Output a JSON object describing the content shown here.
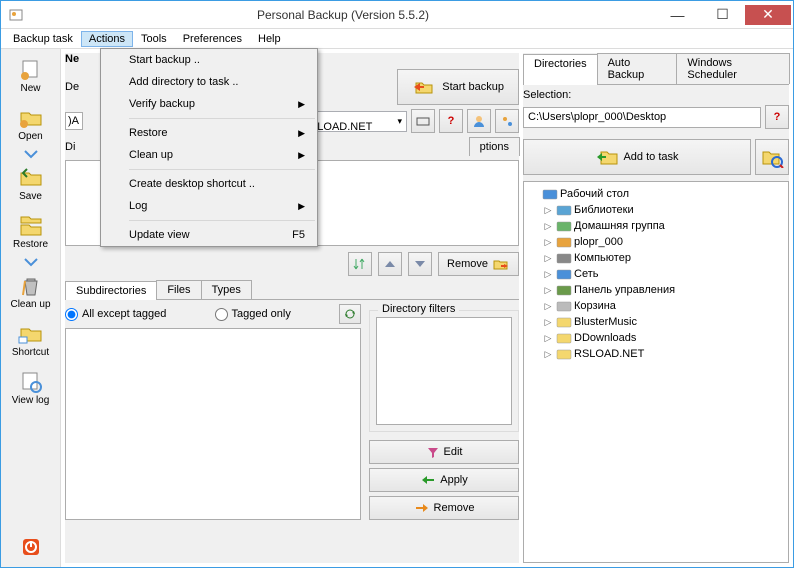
{
  "window": {
    "title": "Personal Backup (Version 5.5.2)"
  },
  "menubar": {
    "items": [
      "Backup task",
      "Actions",
      "Tools",
      "Preferences",
      "Help"
    ],
    "active": 1
  },
  "dropdown": {
    "items": [
      {
        "label": "Start backup ..",
        "type": "item"
      },
      {
        "label": "Add directory to task ..",
        "type": "item"
      },
      {
        "label": "Verify backup",
        "type": "sub"
      },
      {
        "type": "sep"
      },
      {
        "label": "Restore",
        "type": "sub"
      },
      {
        "label": "Clean up",
        "type": "sub"
      },
      {
        "type": "sep"
      },
      {
        "label": "Create desktop shortcut ..",
        "type": "item"
      },
      {
        "label": "Log",
        "type": "sub"
      },
      {
        "type": "sep"
      },
      {
        "label": "Update view",
        "type": "item",
        "key": "F5"
      }
    ]
  },
  "sidebar": [
    {
      "label": "New"
    },
    {
      "label": "Open"
    },
    {
      "label": "Save"
    },
    {
      "label": "Restore"
    },
    {
      "label": "Clean up"
    },
    {
      "label": "Shortcut"
    },
    {
      "label": "View log"
    }
  ],
  "left": {
    "truncated_label1": "Ne",
    "truncated_label2": "De",
    "truncated_label3": ")A",
    "truncated_label4": "Di",
    "start_backup": "Start backup",
    "combo_value": "ET RSLOAD.NET",
    "tabs2": [
      "ptions"
    ],
    "remove": "Remove",
    "sub_tabs": [
      "Subdirectories",
      "Files",
      "Types"
    ],
    "radio_all": "All except tagged",
    "radio_tagged": "Tagged only",
    "dir_filters": "Directory filters",
    "edit": "Edit",
    "apply": "Apply",
    "remove2": "Remove"
  },
  "right": {
    "tabs": [
      "Directories",
      "Auto Backup",
      "Windows Scheduler"
    ],
    "selection": "Selection:",
    "path": "C:\\Users\\plopr_000\\Desktop",
    "add_to_task": "Add to task",
    "tree": [
      {
        "label": "Рабочий стол",
        "depth": 0,
        "icon": "desktop",
        "expanded": true
      },
      {
        "label": "Библиотеки",
        "depth": 1,
        "icon": "lib"
      },
      {
        "label": "Домашняя группа",
        "depth": 1,
        "icon": "home"
      },
      {
        "label": "plopr_000",
        "depth": 1,
        "icon": "user"
      },
      {
        "label": "Компьютер",
        "depth": 1,
        "icon": "pc"
      },
      {
        "label": "Сеть",
        "depth": 1,
        "icon": "net"
      },
      {
        "label": "Панель управления",
        "depth": 1,
        "icon": "panel"
      },
      {
        "label": "Корзина",
        "depth": 1,
        "icon": "trash"
      },
      {
        "label": "BlusterMusic",
        "depth": 1,
        "icon": "folder"
      },
      {
        "label": "DDownloads",
        "depth": 1,
        "icon": "folder"
      },
      {
        "label": "RSLOAD.NET",
        "depth": 1,
        "icon": "folder"
      }
    ]
  }
}
